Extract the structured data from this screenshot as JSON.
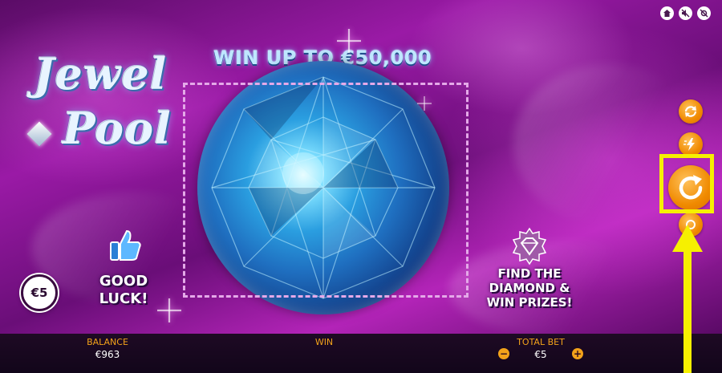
{
  "game": {
    "title_line1": "Jewel",
    "title_line2": "Pool",
    "headline": "WIN UP TO €50,000",
    "bet_chip": "€5",
    "good_luck": "GOOD LUCK!",
    "find_prize": "FIND THE DIAMOND & WIN PRIZES!"
  },
  "top_controls": [
    {
      "icon": "home-icon"
    },
    {
      "icon": "sound-off-icon"
    },
    {
      "icon": "settings-off-icon"
    }
  ],
  "side_controls": {
    "autoplay_icon": "autoplay-icon",
    "turbo_icon": "turbo-icon",
    "play_icon": "replay-icon",
    "bet_icon": "bet-icon"
  },
  "bottom_bar": {
    "balance_label": "BALANCE",
    "balance_value": "€963",
    "win_label": "WIN",
    "win_value": "",
    "total_bet_label": "TOTAL BET",
    "total_bet_value": "€5",
    "decrease_symbol": "−",
    "increase_symbol": "+"
  },
  "colors": {
    "accent_orange": "#f08a00",
    "highlight_yellow": "#f6f000",
    "label_orange": "#f2a21a",
    "gem_blue": "#2a9ee0",
    "background_purple": "#9a1aa6"
  }
}
